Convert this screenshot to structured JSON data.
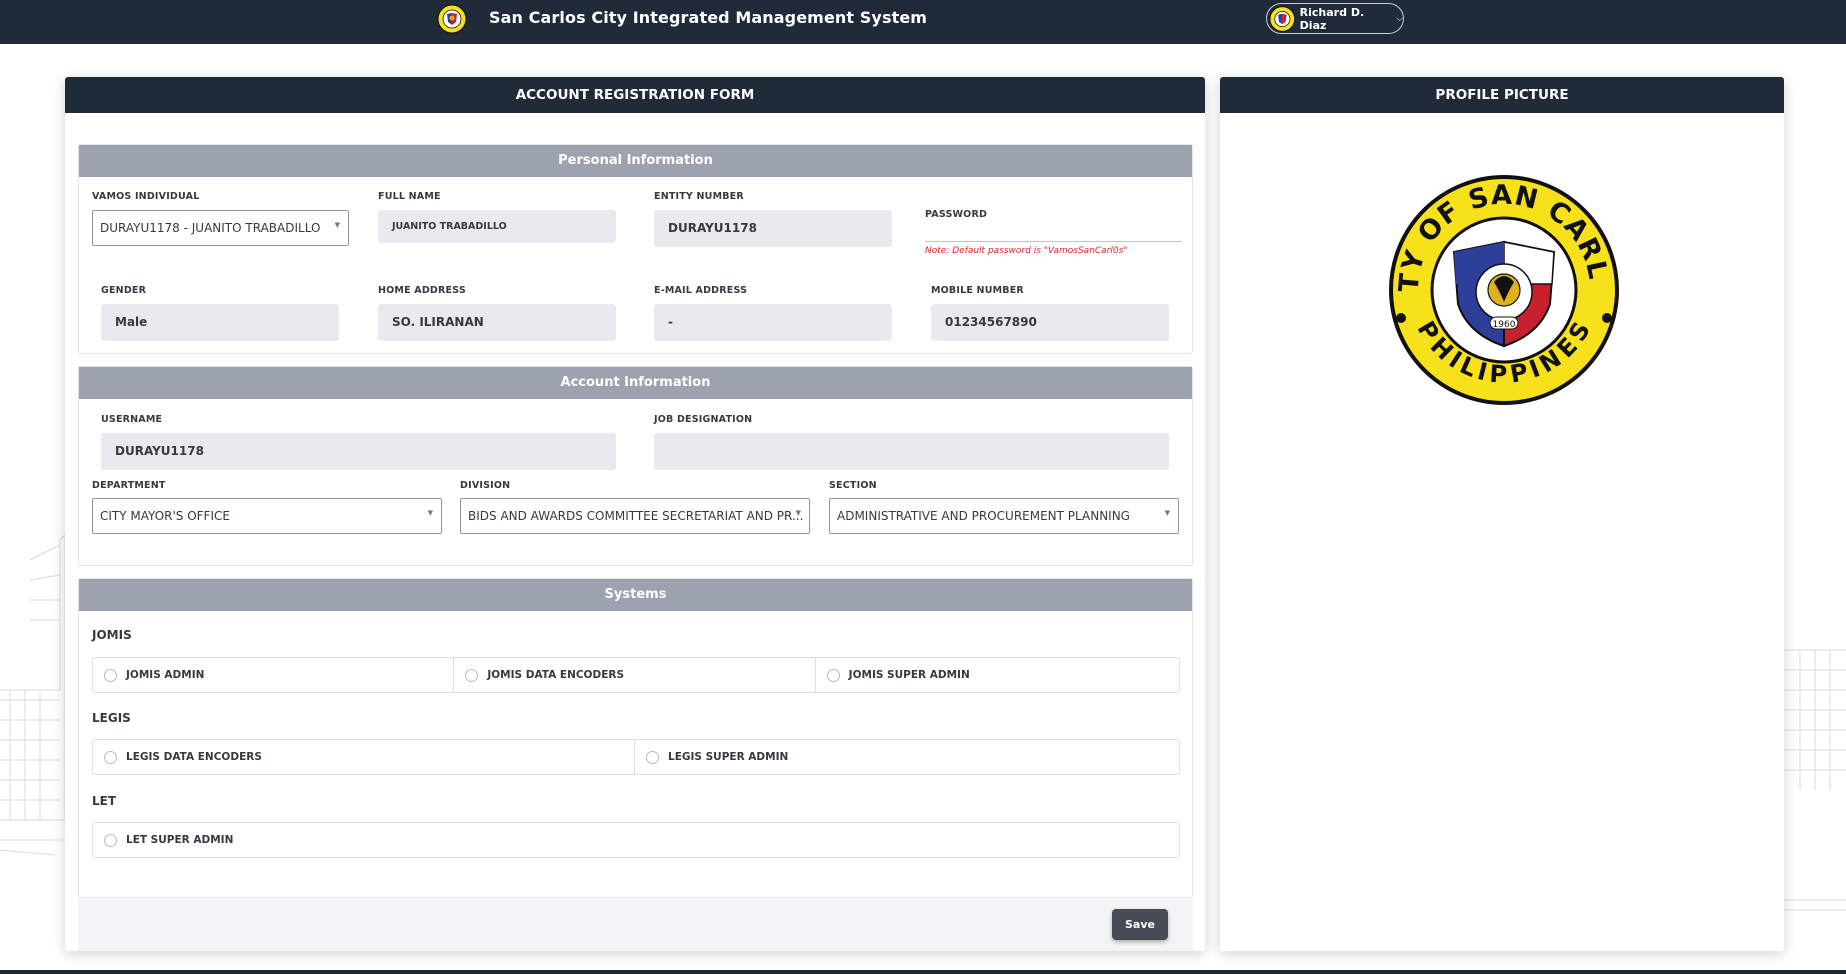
{
  "app": {
    "title": "San Carlos City Integrated Management System",
    "user_name": "Richard D. Diaz"
  },
  "form": {
    "header": "ACCOUNT REGISTRATION FORM",
    "personal": {
      "section_title": "Personal Information",
      "vamos_label": "VAMOS INDIVIDUAL",
      "vamos_value": "DURAYU1178 - JUANITO TRABADILLO",
      "fullname_label": "FULL NAME",
      "fullname_value": "JUANITO TRABADILLO",
      "entity_label": "ENTITY NUMBER",
      "entity_value": "DURAYU1178",
      "password_label": "PASSWORD",
      "password_note": "Note: Default password is \"VamosSanCarl0s\"",
      "gender_label": "GENDER",
      "gender_value": "Male",
      "address_label": "HOME ADDRESS",
      "address_value": "SO. ILIRANAN",
      "email_label": "E-MAIL ADDRESS",
      "email_value": "-",
      "mobile_label": "MOBILE NUMBER",
      "mobile_value": "01234567890"
    },
    "account": {
      "section_title": "Account Information",
      "username_label": "USERNAME",
      "username_value": "DURAYU1178",
      "job_label": "JOB DESIGNATION",
      "job_value": "",
      "department_label": "DEPARTMENT",
      "department_value": "CITY MAYOR'S OFFICE",
      "division_label": "DIVISION",
      "division_value": "BIDS AND AWARDS COMMITTEE SECRETARIAT AND PR...",
      "section_label": "SECTION",
      "section_value": "ADMINISTRATIVE AND PROCUREMENT PLANNING"
    },
    "systems": {
      "section_title": "Systems",
      "groups": [
        {
          "name": "JOMIS",
          "options": [
            "JOMIS ADMIN",
            "JOMIS DATA ENCODERS",
            "JOMIS SUPER ADMIN"
          ]
        },
        {
          "name": "LEGIS",
          "options": [
            "LEGIS DATA ENCODERS",
            "LEGIS SUPER ADMIN"
          ]
        },
        {
          "name": "LET",
          "options": [
            "LET SUPER ADMIN"
          ]
        }
      ]
    },
    "save_label": "Save"
  },
  "profile": {
    "header": "PROFILE PICTURE",
    "seal_text_top": "CITY OF SAN CARLOS",
    "seal_text_bottom": "PHILIPPINES",
    "seal_year": "1960"
  },
  "colors": {
    "navbar": "#212a38",
    "section_header": "#9ca3ae",
    "note_red": "#dc2626",
    "seal_yellow": "#f7e11b",
    "seal_blue": "#2d3f99",
    "seal_red": "#c8202d"
  }
}
